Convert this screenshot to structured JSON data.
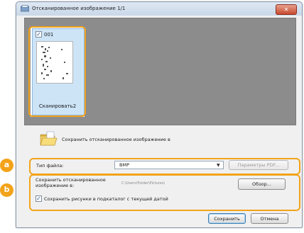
{
  "window": {
    "title": "Отсканированное изображение 1/1",
    "close_glyph": "✕"
  },
  "thumbnail": {
    "checked": true,
    "check_glyph": "✓",
    "number": "001",
    "label": "Сканировать2"
  },
  "save_section": {
    "label": "Сохранить отсканированное изображение в"
  },
  "file_type": {
    "label": "Тип файла:",
    "selected": "BMP",
    "arrow": "▼",
    "params_button": "Параметры PDF..."
  },
  "save_path": {
    "label": "Сохранить отсканированное изображение в:",
    "value": "C:\\Users\\Folder\\Pictures\\",
    "browse_button": "Обзор...",
    "subfolder_checked": true,
    "subfolder_label": "Сохранить рисунки в подкаталог с текущей датой"
  },
  "footer": {
    "save_button": "Сохранить",
    "cancel_button": "Отмена"
  },
  "markers": {
    "a": "a",
    "b": "b"
  },
  "colors": {
    "accent_orange": "#f3a31a",
    "preview_background": "#8c8c8c",
    "thumbnail_selection": "#cde4f7"
  },
  "icons": [
    "window-scan-icon",
    "close-icon",
    "folder-icon",
    "dropdown-arrow-icon",
    "checkbox-checked-icon"
  ]
}
